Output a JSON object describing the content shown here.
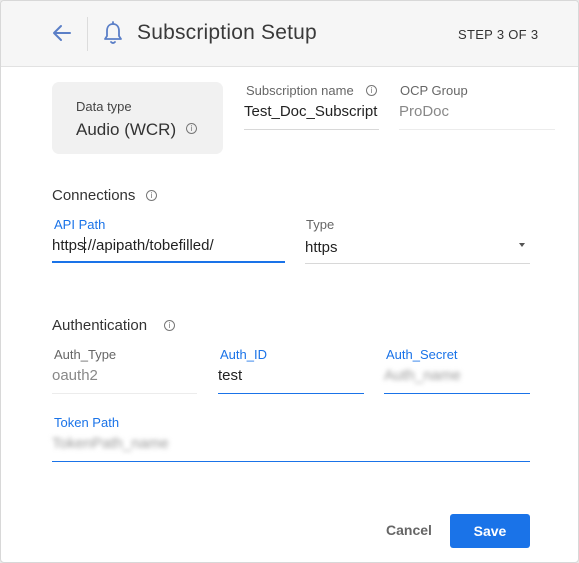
{
  "header": {
    "title": "Subscription Setup",
    "step": "STEP 3 OF 3"
  },
  "data_type": {
    "label": "Data type",
    "value": "Audio (WCR)"
  },
  "subscription_name": {
    "label": "Subscription name",
    "value": "Test_Doc_Subscript"
  },
  "ocp_group": {
    "label": "OCP Group",
    "value": "ProDoc"
  },
  "connections": {
    "title": "Connections",
    "api_path": {
      "label": "API Path",
      "value_before_cursor": "https",
      "value_after_cursor": "://apipath/tobefilled/"
    },
    "type": {
      "label": "Type",
      "value": "https"
    }
  },
  "authentication": {
    "title": "Authentication",
    "auth_type": {
      "label": "Auth_Type",
      "value": "oauth2"
    },
    "auth_id": {
      "label": "Auth_ID",
      "value": "test"
    },
    "auth_secret": {
      "label": "Auth_Secret",
      "value": "Auth_name"
    },
    "token_path": {
      "label": "Token Path",
      "value": "TokenPath_name"
    }
  },
  "footer": {
    "cancel_label": "Cancel",
    "save_label": "Save"
  },
  "colors": {
    "accent": "#1a73e8",
    "header_bg": "#f6f6f6"
  },
  "icons": {
    "back": "arrow-left-icon",
    "bell": "bell-icon",
    "info": "info-icon",
    "caret": "caret-down-icon"
  }
}
